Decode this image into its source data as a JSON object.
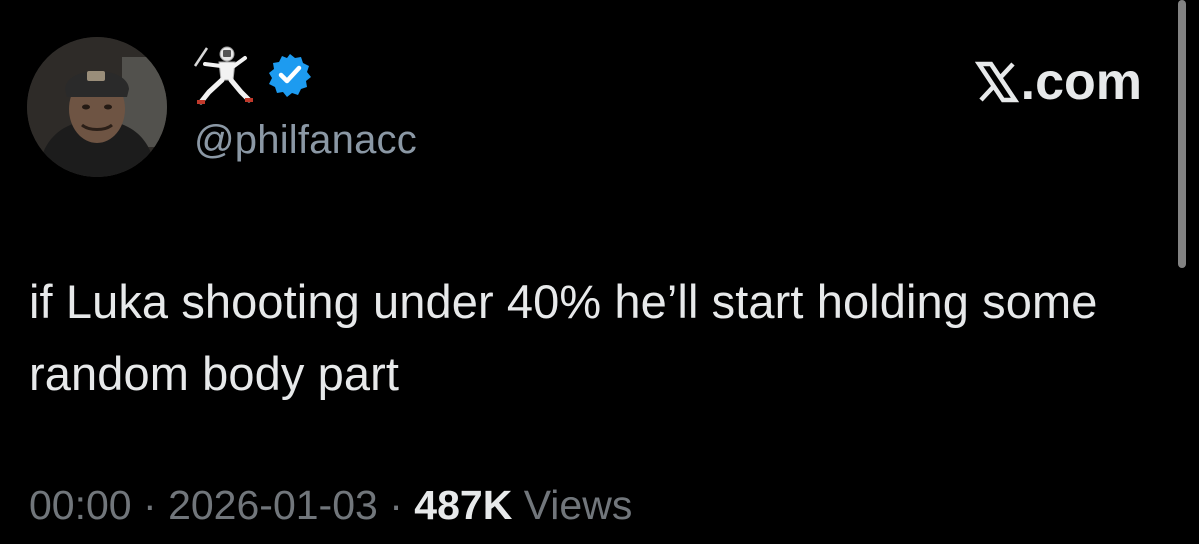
{
  "tweet": {
    "author": {
      "handle": "@philfanacc",
      "avatar_icon": "profile-photo",
      "name_icons": [
        "fencer-emoji-icon",
        "verified-badge-icon"
      ]
    },
    "site_label": ".com",
    "site_icon": "x-logo-icon",
    "text": "if Luka shooting under 40% he’ll start holding some random body part",
    "meta": {
      "time": "00:00",
      "separator": "·",
      "date": "2026-01-03",
      "views_count": "487K",
      "views_label": "Views"
    }
  },
  "colors": {
    "background": "#000000",
    "primary_text": "#e7e9ea",
    "secondary_text": "#71767b",
    "verified_blue": "#1d9bf0"
  }
}
